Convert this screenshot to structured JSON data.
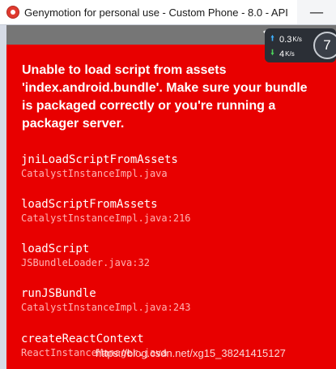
{
  "window": {
    "title": "Genymotion for personal use - Custom Phone - 8.0 - API"
  },
  "error": {
    "message": "Unable to load script from assets 'index.android.bundle'. Make sure your bundle is packaged correctly or you're running a packager server.",
    "stack": [
      {
        "method": "jniLoadScriptFromAssets",
        "file": "CatalystInstanceImpl.java"
      },
      {
        "method": "loadScriptFromAssets",
        "file": "CatalystInstanceImpl.java:216"
      },
      {
        "method": "loadScript",
        "file": "JSBundleLoader.java:32"
      },
      {
        "method": "runJSBundle",
        "file": "CatalystInstanceImpl.java:243"
      },
      {
        "method": "createReactContext",
        "file": "ReactInstanceManager.java"
      }
    ]
  },
  "network_widget": {
    "upload_value": "0.3",
    "upload_unit": "K/s",
    "download_value": "4",
    "download_unit": "K/s",
    "gauge_value": "7"
  },
  "watermark": "https://blog.csdn.net/xg15_38241415127",
  "colors": {
    "error_background": "#e80000",
    "status_bar": "#767676",
    "upload_arrow": "#3fb0ff",
    "download_arrow": "#4cd15a"
  }
}
